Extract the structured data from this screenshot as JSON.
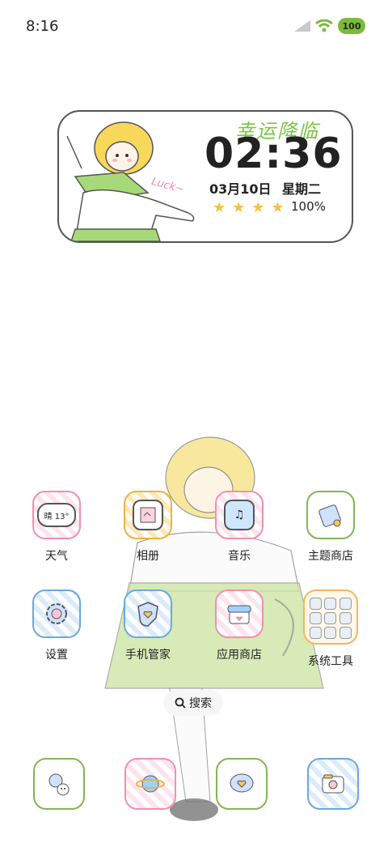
{
  "status_bar": {
    "time": "8:16",
    "battery": "100",
    "icons": [
      "signal-icon",
      "wifi-icon",
      "battery-icon"
    ]
  },
  "widget": {
    "slogan": "幸运降临",
    "time": "02:36",
    "date": "03月10日",
    "weekday": "星期二",
    "battery": "100%",
    "luck": "Luck~"
  },
  "apps": [
    {
      "label": "天气",
      "icon": "weather-icon",
      "badge": "晴 13°"
    },
    {
      "label": "相册",
      "icon": "gallery-icon"
    },
    {
      "label": "音乐",
      "icon": "music-icon"
    },
    {
      "label": "主题商店",
      "icon": "theme-store-icon"
    },
    {
      "label": "设置",
      "icon": "settings-icon"
    },
    {
      "label": "手机管家",
      "icon": "security-icon"
    },
    {
      "label": "应用商店",
      "icon": "app-store-icon"
    },
    {
      "label": "系统工具",
      "icon": "folder-icon"
    }
  ],
  "search": {
    "label": "搜索"
  },
  "dock": [
    {
      "icon": "phone-icon"
    },
    {
      "icon": "browser-icon"
    },
    {
      "icon": "messages-icon"
    },
    {
      "icon": "camera-icon"
    }
  ],
  "colors": {
    "pink": "#f28fb0",
    "yellow": "#f0b23c",
    "green": "#83b655",
    "blue": "#6aa8e0",
    "battery": "#7cba3c"
  }
}
